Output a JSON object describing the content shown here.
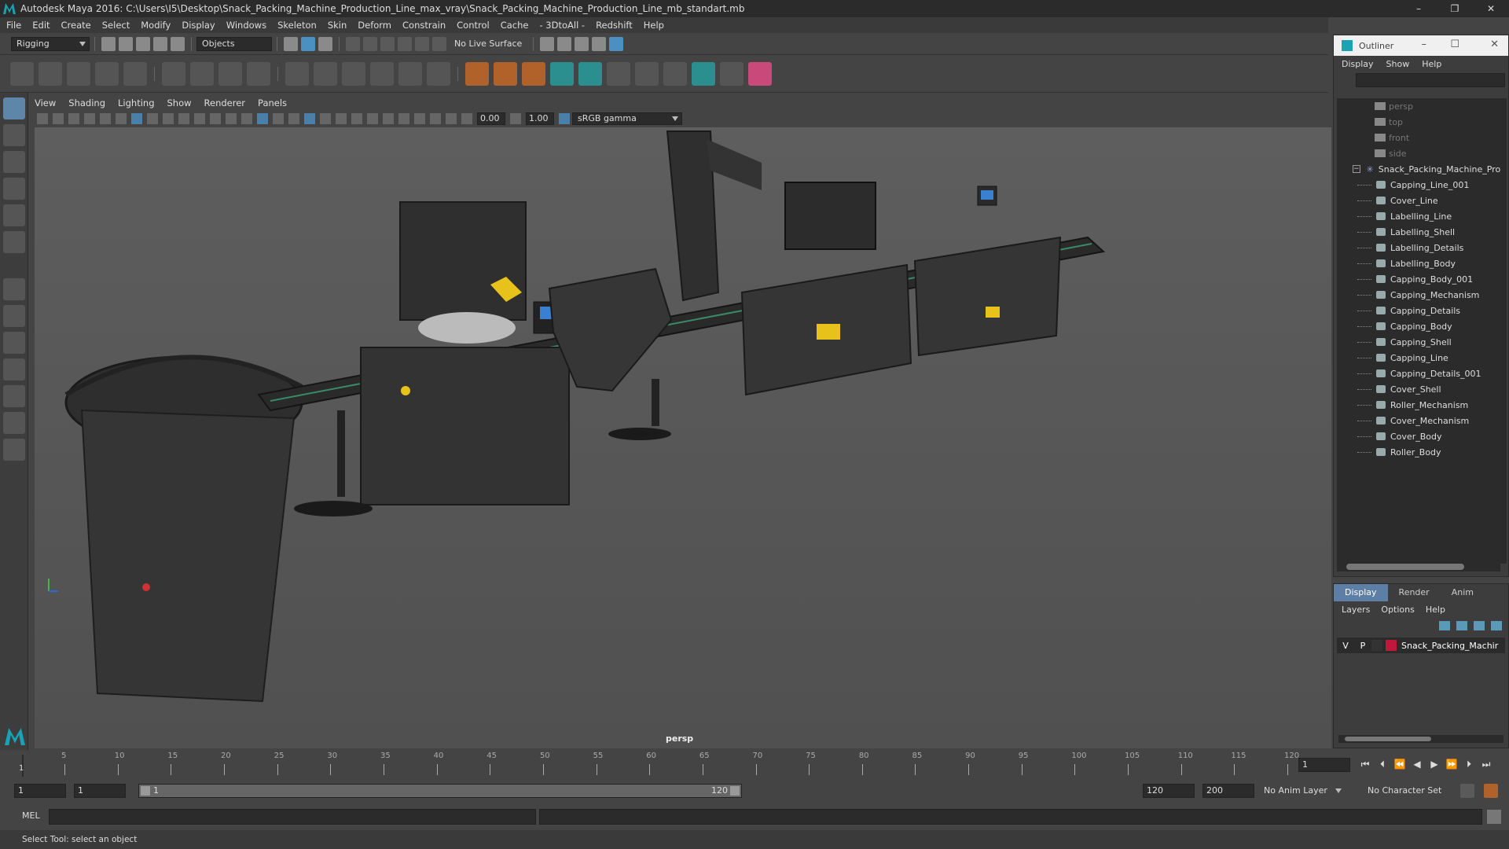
{
  "window": {
    "title": "Autodesk Maya 2016: C:\\Users\\I5\\Desktop\\Snack_Packing_Machine_Production_Line_max_vray\\Snack_Packing_Machine_Production_Line_mb_standart.mb",
    "minimize": "–",
    "restore": "❐",
    "close": "✕"
  },
  "menubar": [
    "File",
    "Edit",
    "Create",
    "Select",
    "Modify",
    "Display",
    "Windows",
    "Skeleton",
    "Skin",
    "Deform",
    "Constrain",
    "Control",
    "Cache",
    "- 3DtoAll -",
    "Redshift",
    "Help"
  ],
  "statusline": {
    "menuset": "Rigging",
    "selection_mode": "Objects",
    "live_surface": "No Live Surface"
  },
  "panel": {
    "menu": [
      "View",
      "Shading",
      "Lighting",
      "Show",
      "Renderer",
      "Panels"
    ],
    "exposure": "0.00",
    "gamma_value": "1.00",
    "color_space": "sRGB gamma",
    "camera_label": "persp"
  },
  "outliner": {
    "title": "Outliner",
    "menu": [
      "Display",
      "Show",
      "Help"
    ],
    "cameras": [
      "persp",
      "top",
      "front",
      "side"
    ],
    "root": "Snack_Packing_Machine_Pro",
    "children": [
      "Capping_Line_001",
      "Cover_Line",
      "Labelling_Line",
      "Labelling_Shell",
      "Labelling_Details",
      "Labelling_Body",
      "Capping_Body_001",
      "Capping_Mechanism",
      "Capping_Details",
      "Capping_Body",
      "Capping_Shell",
      "Capping_Line",
      "Capping_Details_001",
      "Cover_Shell",
      "Roller_Mechanism",
      "Cover_Mechanism",
      "Cover_Body",
      "Roller_Body"
    ]
  },
  "layers": {
    "tabs": [
      "Display",
      "Render",
      "Anim"
    ],
    "menu": [
      "Layers",
      "Options",
      "Help"
    ],
    "row": {
      "v": "V",
      "p": "P",
      "name": "Snack_Packing_Machir"
    }
  },
  "timeline": {
    "ticks": [
      5,
      10,
      15,
      20,
      25,
      30,
      35,
      40,
      45,
      50,
      55,
      60,
      65,
      70,
      75,
      80,
      85,
      90,
      95,
      100,
      105,
      110,
      115,
      120
    ],
    "current_frame": "1",
    "frame_field": "1",
    "start": "1",
    "playback_start": "1",
    "range_start_label": "1",
    "range_end_label": "120",
    "end": "120",
    "anim_end": "200",
    "anim_layer": "No Anim Layer",
    "character_set": "No Character Set"
  },
  "command": {
    "language": "MEL"
  },
  "help_text": "Select Tool: select an object"
}
